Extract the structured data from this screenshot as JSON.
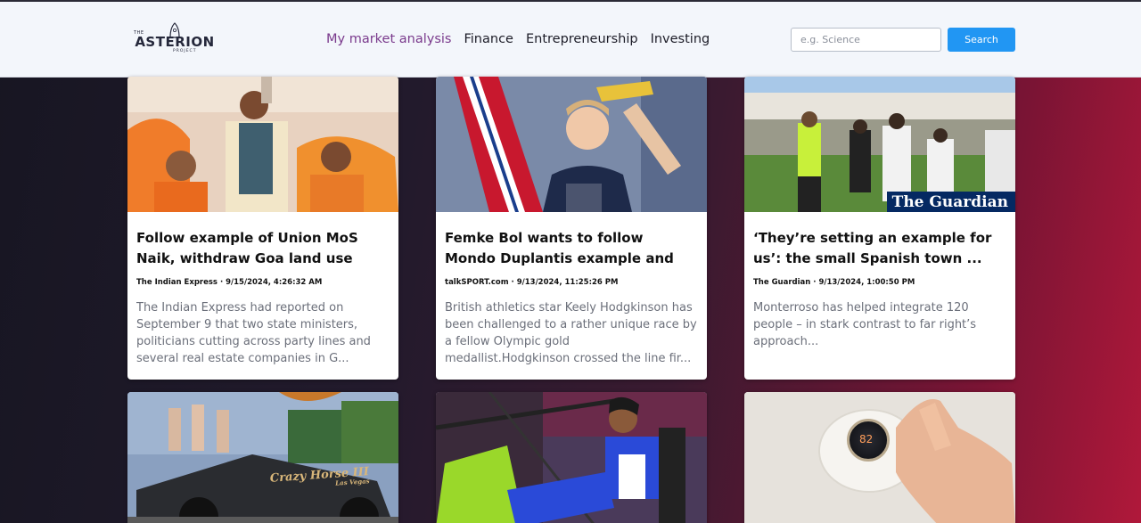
{
  "header": {
    "logo": {
      "top": "THE",
      "name": "ASTERION",
      "bottom": "PROJECT"
    },
    "nav": [
      {
        "label": "My market analysis",
        "active": true
      },
      {
        "label": "Finance",
        "active": false
      },
      {
        "label": "Entrepreneurship",
        "active": false
      },
      {
        "label": "Investing",
        "active": false
      }
    ],
    "search": {
      "placeholder": "e.g. Science",
      "value": "",
      "button_label": "Search"
    }
  },
  "colors": {
    "accent": "#2196f3",
    "nav_active": "#7a3a8c",
    "header_bg": "#f3f6fb"
  },
  "cards": [
    {
      "title": "Follow example of Union MoS Naik, withdraw Goa land use appl...",
      "meta": "The Indian Express · 9/15/2024, 4:26:32 AM",
      "description": "The Indian Express had reported on September 9 that two state ministers, politicians cutting across party lines and several real estate companies in G...",
      "image": "politicians-with-garlands-photo"
    },
    {
      "title": "Femke Bol wants to follow Mondo Duplantis example and race T...",
      "meta": "talkSPORT.com · 9/13/2024, 11:25:26 PM",
      "description": "British athletics star Keely Hodgkinson has been challenged to a rather unique race by a fellow Olympic gold medallist.Hodgkinson crossed the line fir...",
      "image": "athlete-celebrating-photo"
    },
    {
      "title": "‘They’re setting an example for us’: the small Spanish town ...",
      "meta": "The Guardian · 9/13/2024, 1:00:50 PM",
      "description": "Monterroso has helped integrate 120 people – in stark contrast to far right’s approach...",
      "image": "football-handshake-photo",
      "image_badge": "The Guardian"
    },
    {
      "image": "cybertruck-photo",
      "image_text": "Crazy Horse III",
      "image_subtext": "Las Vegas"
    },
    {
      "image": "para-archery-photo"
    },
    {
      "image": "smart-thermostat-photo",
      "image_text": "82"
    }
  ]
}
